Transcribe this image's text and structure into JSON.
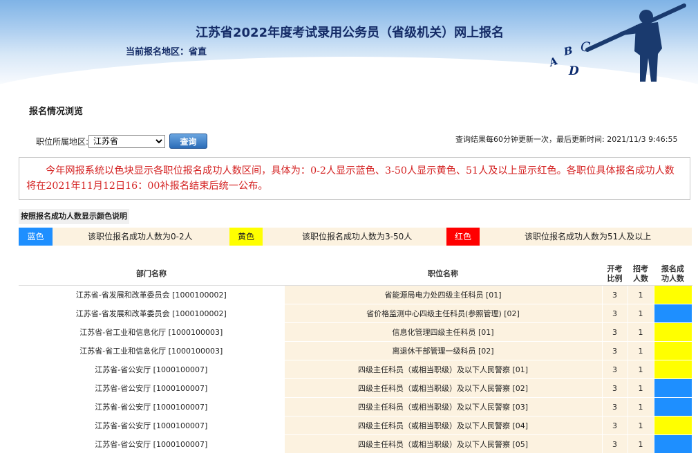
{
  "header": {
    "title": "江苏省2022年度考试录用公务员（省级机关）网上报名",
    "region_label": "当前报名地区：省直"
  },
  "page": {
    "subtitle": "报名情况浏览"
  },
  "filter": {
    "label": "职位所属地区:",
    "selected": "江苏省",
    "query_button": "查询"
  },
  "update_info": "查询结果每60分钟更新一次，最后更新时间: 2021/11/3 9:46:55",
  "notice": "今年网报系统以色块显示各职位报名成功人数区间，具体为：0-2人显示蓝色、3-50人显示黄色、51人及以上显示红色。各职位具体报名成功人数将在2021年11月12日16：00补报名结束后统一公布。",
  "legend": {
    "title": "按照报名成功人数显示颜色说明",
    "items": [
      {
        "label": "蓝色",
        "color": "#1e8fff",
        "text": "该职位报名成功人数为0-2人"
      },
      {
        "label": "黄色",
        "color": "#ffff00",
        "text": "该职位报名成功人数为3-50人"
      },
      {
        "label": "红色",
        "color": "#ff0000",
        "text": "该职位报名成功人数为51人及以上"
      }
    ]
  },
  "table": {
    "headers": {
      "dept": "部门名称",
      "position": "职位名称",
      "ratio_1": "开考",
      "ratio_2": "比例",
      "recruit_1": "招考",
      "recruit_2": "人数",
      "applied_1": "报名成",
      "applied_2": "功人数"
    },
    "rows": [
      {
        "dept": "江苏省-省发展和改革委员会 [1000100002]",
        "position": "省能源局电力处四级主任科员 [01]",
        "ratio": "3",
        "recruit": "1",
        "status": "yellow"
      },
      {
        "dept": "江苏省-省发展和改革委员会 [1000100002]",
        "position": "省价格监测中心四级主任科员(参照管理) [02]",
        "ratio": "3",
        "recruit": "1",
        "status": "blue"
      },
      {
        "dept": "江苏省-省工业和信息化厅 [1000100003]",
        "position": "信息化管理四级主任科员 [01]",
        "ratio": "3",
        "recruit": "1",
        "status": "yellow"
      },
      {
        "dept": "江苏省-省工业和信息化厅 [1000100003]",
        "position": "离退休干部管理一级科员 [02]",
        "ratio": "3",
        "recruit": "1",
        "status": "yellow"
      },
      {
        "dept": "江苏省-省公安厅 [1000100007]",
        "position": "四级主任科员（或相当职级）及以下人民警察 [01]",
        "ratio": "3",
        "recruit": "1",
        "status": "yellow"
      },
      {
        "dept": "江苏省-省公安厅 [1000100007]",
        "position": "四级主任科员（或相当职级）及以下人民警察 [02]",
        "ratio": "3",
        "recruit": "1",
        "status": "blue"
      },
      {
        "dept": "江苏省-省公安厅 [1000100007]",
        "position": "四级主任科员（或相当职级）及以下人民警察 [03]",
        "ratio": "3",
        "recruit": "1",
        "status": "blue"
      },
      {
        "dept": "江苏省-省公安厅 [1000100007]",
        "position": "四级主任科员（或相当职级）及以下人民警察 [04]",
        "ratio": "3",
        "recruit": "1",
        "status": "yellow"
      },
      {
        "dept": "江苏省-省公安厅 [1000100007]",
        "position": "四级主任科员（或相当职级）及以下人民警察 [05]",
        "ratio": "3",
        "recruit": "1",
        "status": "blue"
      }
    ]
  },
  "colors": {
    "blue": "#1e8fff",
    "yellow": "#ffff00",
    "red": "#ff0000",
    "title": "#142b66",
    "notice": "#d42222"
  },
  "decoration_icon": "abcd-figure-illustration"
}
